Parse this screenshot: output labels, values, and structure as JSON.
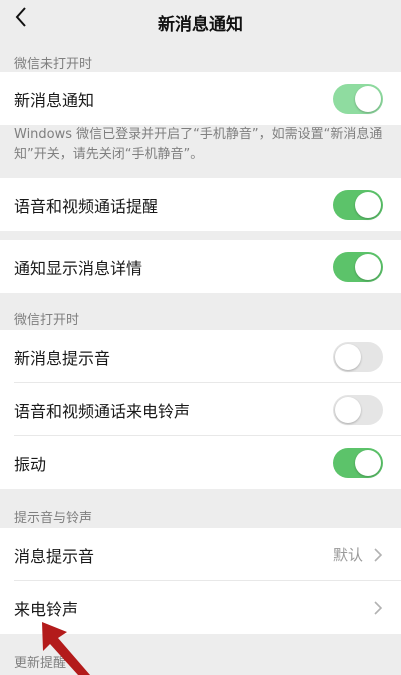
{
  "nav": {
    "title": "新消息通知"
  },
  "section_wechat_closed": "微信未打开时",
  "row_new_msg": {
    "label": "新消息通知",
    "toggle": "on"
  },
  "note": "Windows 微信已登录并开启了“手机静音”，如需设置“新消息通知”开关，请先关闭“手机静音”。",
  "row_voice_video": {
    "label": "语音和视频通话提醒",
    "toggle": "on"
  },
  "row_show_details": {
    "label": "通知显示消息详情",
    "toggle": "on"
  },
  "section_wechat_open": "微信打开时",
  "row_msg_sound": {
    "label": "新消息提示音",
    "toggle": "off"
  },
  "row_call_ringtone": {
    "label": "语音和视频通话来电铃声",
    "toggle": "off"
  },
  "row_vibrate": {
    "label": "振动",
    "toggle": "on"
  },
  "section_sounds": "提示音与铃声",
  "row_message_tone": {
    "label": "消息提示音",
    "value": "默认"
  },
  "row_incoming_ringtone": {
    "label": "来电铃声"
  },
  "section_updates": "更新提醒",
  "colors": {
    "accent_green": "#5cc36a",
    "arrow_red": "#b31b1b"
  }
}
